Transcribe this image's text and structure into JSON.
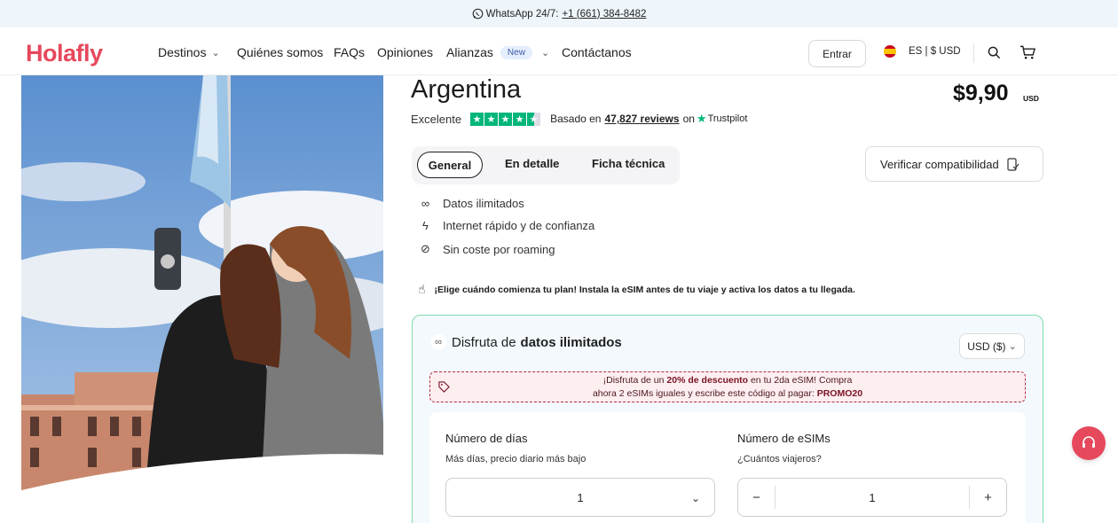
{
  "topbar": {
    "whatsapp_label": "WhatsApp 24/7:",
    "phone": "+1 (661) 384-8482"
  },
  "brand": {
    "logo": "Holafly",
    "accent": "#e6485c"
  },
  "nav": {
    "items": [
      {
        "label": "Destinos",
        "dropdown": true
      },
      {
        "label": "Quiénes somos"
      },
      {
        "label": "FAQs"
      },
      {
        "label": "Opiniones"
      },
      {
        "label": "Alianzas",
        "badge": "New",
        "dropdown": true
      },
      {
        "label": "Contáctanos"
      }
    ],
    "login_label": "Entrar",
    "language": "ES | $ USD"
  },
  "product": {
    "title": "Argentina",
    "price": "$9,90",
    "currency": "USD",
    "rating_word": "Excelente",
    "rating_stars": 4.5,
    "based_on": "Basado en",
    "reviews_count": "47,827 reviews",
    "on_label": "on",
    "trustpilot": "Trustpilot"
  },
  "tabs": [
    "General",
    "En detalle",
    "Ficha técnica"
  ],
  "verify_label": "Verificar compatibilidad",
  "features": [
    {
      "icon": "infinity-icon",
      "text": "Datos ilimitados"
    },
    {
      "icon": "lightning-icon",
      "text": "Internet rápido y de confianza"
    },
    {
      "icon": "no-roaming-icon",
      "text": "Sin coste por roaming"
    }
  ],
  "activation_note": "¡Elige cuándo comienza tu plan! Instala la eSIM antes de tu viaje y activa los datos a tu llegada.",
  "plan": {
    "heading_prefix": "Disfruta de",
    "heading_bold": "datos ilimitados",
    "currency_select": "USD ($)",
    "discount_line1_a": "¡Disfruta de un",
    "discount_line1_bold": "20% de descuento",
    "discount_line1_b": "en tu 2da eSIM! Compra",
    "discount_line2_a": "ahora 2 eSIMs iguales y escribe este código al pagar:",
    "discount_code": "PROMO20",
    "days_label": "Número de días",
    "days_sub": "Más días, precio diario más bajo",
    "days_value": "1",
    "esims_label": "Número de eSIMs",
    "esims_sub": "¿Cuántos viajeros?",
    "esims_value": "1"
  }
}
